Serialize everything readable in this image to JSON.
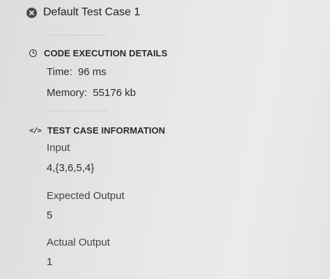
{
  "header": {
    "title": "Default Test Case 1",
    "status_icon": "x-circle-icon"
  },
  "execution": {
    "heading": "CODE EXECUTION DETAILS",
    "icon": "clock-icon",
    "time_label": "Time:",
    "time_value": "96 ms",
    "memory_label": "Memory:",
    "memory_value": "55176 kb"
  },
  "testcase": {
    "heading": "TEST CASE INFORMATION",
    "icon": "code-icon",
    "input_label": "Input",
    "input_value": "4,{3,6,5,4}",
    "expected_label": "Expected Output",
    "expected_value": "5",
    "actual_label": "Actual Output",
    "actual_value": "1"
  }
}
